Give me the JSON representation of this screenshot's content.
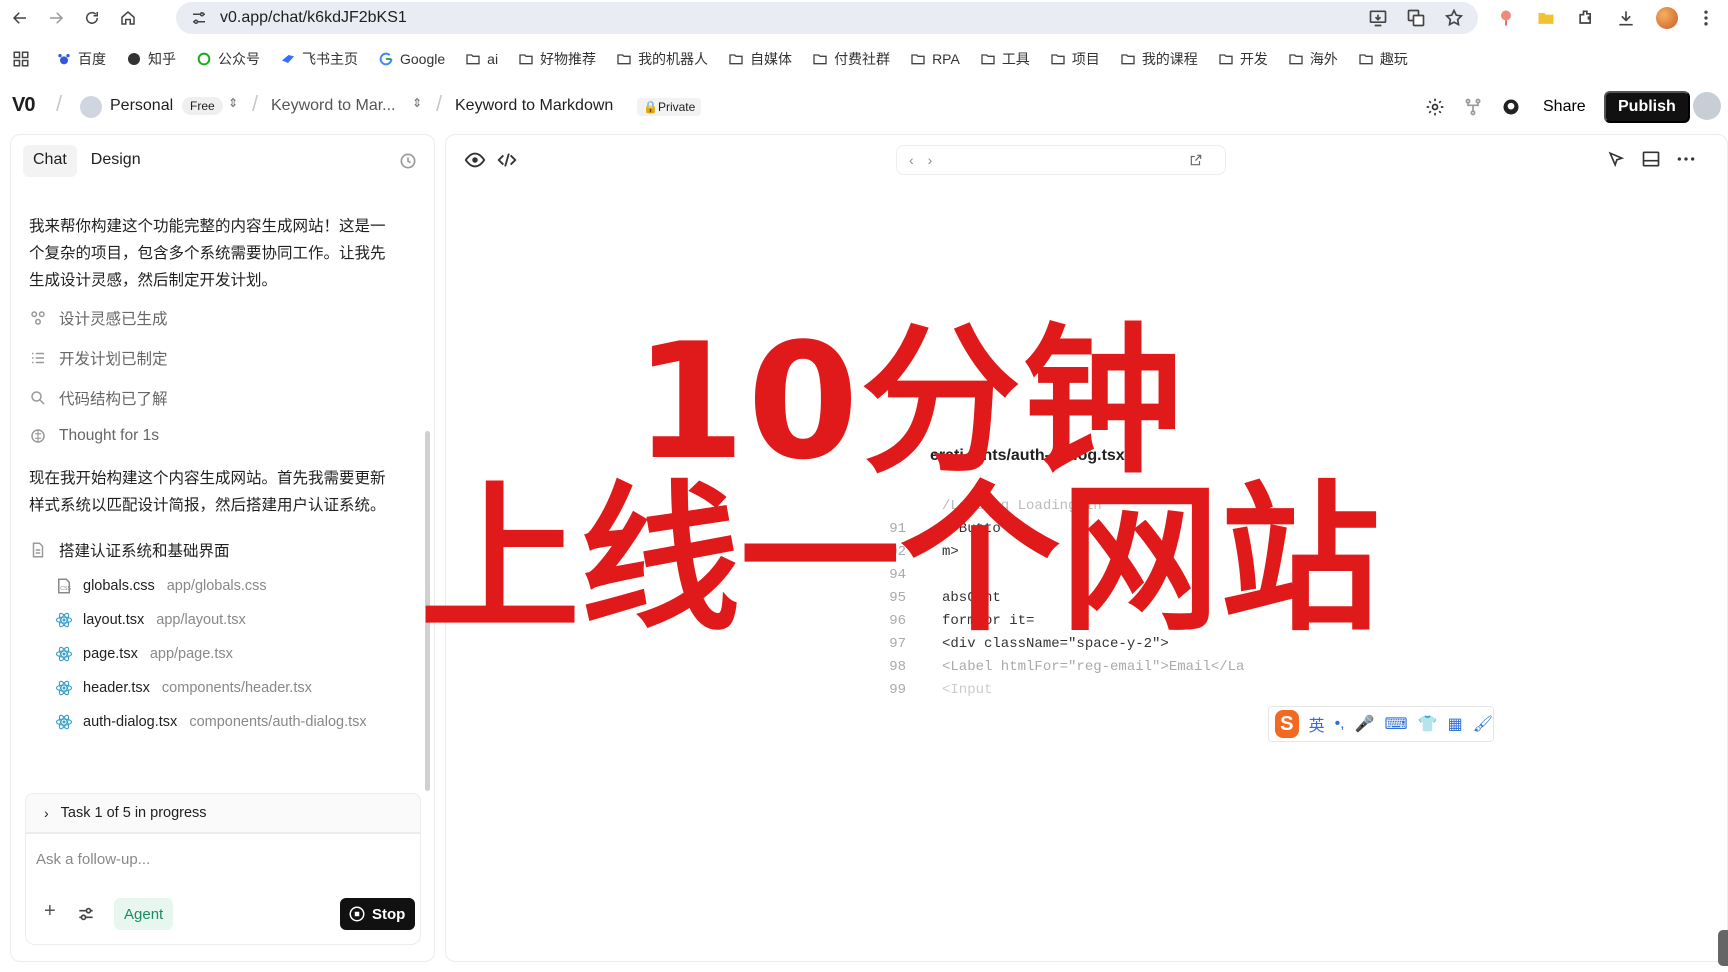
{
  "browser": {
    "url": "v0.app/chat/k6kdJF2bKS1"
  },
  "bookmarks": [
    "百度",
    "知乎",
    "公众号",
    "飞书主页",
    "Google",
    "ai",
    "好物推荐",
    "我的机器人",
    "自媒体",
    "付费社群",
    "RPA",
    "工具",
    "项目",
    "我的课程",
    "开发",
    "海外",
    "趣玩"
  ],
  "header": {
    "logo": "V0",
    "workspace": "Personal",
    "plan_badge": "Free",
    "project": "Keyword to Mar...",
    "chat_title": "Keyword to Markdown",
    "visibility": "Private",
    "share_label": "Share",
    "publish_label": "Publish"
  },
  "chat": {
    "tabs": [
      "Chat",
      "Design"
    ],
    "msg1": "我来帮你构建这个功能完整的内容生成网站！这是一个复杂的项目，包含多个系统需要协同工作。让我先生成设计灵感，然后制定开发计划。",
    "steps": [
      "设计灵感已生成",
      "开发计划已制定",
      "代码结构已了解",
      "Thought for 1s"
    ],
    "msg2": "现在我开始构建这个内容生成网站。首先我需要更新样式系统以匹配设计简报，然后搭建用户认证系统。",
    "task_group": "搭建认证系统和基础界面",
    "files": [
      {
        "name": "globals.css",
        "path": "app/globals.css"
      },
      {
        "name": "layout.tsx",
        "path": "app/layout.tsx"
      },
      {
        "name": "page.tsx",
        "path": "app/page.tsx"
      },
      {
        "name": "header.tsx",
        "path": "components/header.tsx"
      },
      {
        "name": "auth-dialog.tsx",
        "path": "components/auth-dialog.tsx"
      }
    ],
    "task_status": "Task 1 of 5 in progress",
    "input_placeholder": "Ask a follow-up...",
    "agent_label": "Agent",
    "stop_label": "Stop"
  },
  "preview": {
    "code_title": "erati   p   nts/auth-dialog.tsx",
    "code_lines": [
      {
        "ln": "",
        "code": " /Loading  Loading in"
      },
      {
        "ln": "91",
        "code": "  </Butto"
      },
      {
        "ln": "92",
        "code": "   m>"
      },
      {
        "ln": "94",
        "code": ""
      },
      {
        "ln": "95",
        "code": "  absCont"
      },
      {
        "ln": "96",
        "code": "  form or  it=   "
      },
      {
        "ln": "97",
        "code": "  <div className=\"space-y-2\">"
      },
      {
        "ln": "98",
        "code": "   <Label htmlFor=\"reg-email\">Email</La"
      },
      {
        "ln": "99",
        "code": "   <Input"
      }
    ]
  },
  "overlay": {
    "line1": "10分钟",
    "line2": "上线一个网站"
  },
  "ime": {
    "logo": "S",
    "lang": "英"
  }
}
